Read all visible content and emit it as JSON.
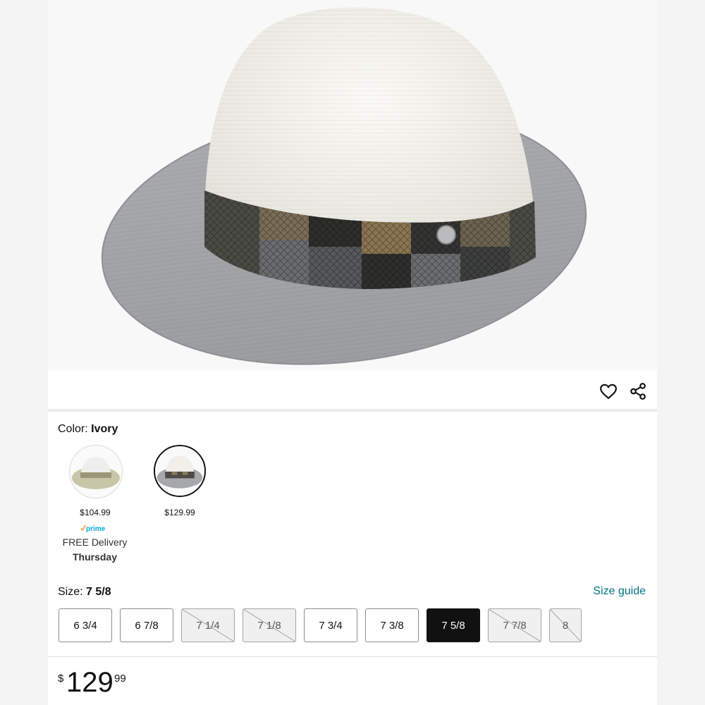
{
  "product": {
    "color_label": "Color:",
    "color_value": "Ivory",
    "size_label": "Size:",
    "size_value": "7 5/8",
    "size_guide": "Size guide"
  },
  "actions": {
    "favorite_icon": "heart-icon",
    "share_icon": "share-icon"
  },
  "swatches": [
    {
      "price": "$104.99",
      "prime": "prime",
      "delivery": "FREE Delivery",
      "day": "Thursday"
    },
    {
      "price": "$129.99"
    }
  ],
  "sizes": [
    {
      "label": "6 3/4",
      "state": "available"
    },
    {
      "label": "6 7/8",
      "state": "available"
    },
    {
      "label": "7 1/4",
      "state": "unavailable"
    },
    {
      "label": "7 1/8",
      "state": "unavailable"
    },
    {
      "label": "7 3/4",
      "state": "available"
    },
    {
      "label": "7 3/8",
      "state": "available"
    },
    {
      "label": "7 5/8",
      "state": "selected"
    },
    {
      "label": "7 7/8",
      "state": "unavailable"
    },
    {
      "label": "8",
      "state": "unavailable"
    }
  ],
  "price": {
    "currency": "$",
    "whole": "129",
    "fraction": "99"
  },
  "colors": {
    "link": "#007185",
    "prime": "#00a8e1",
    "selected": "#111111"
  }
}
